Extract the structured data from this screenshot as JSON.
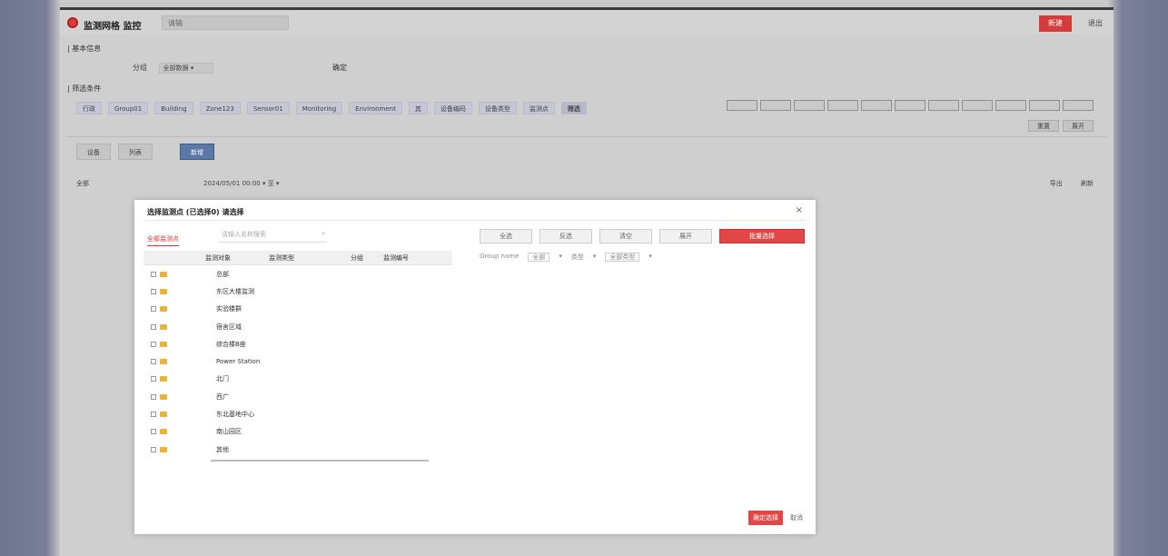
{
  "app": {
    "title": "监测网格 监控",
    "search_placeholder": "请输",
    "top_button": "新建",
    "user": "退出"
  },
  "section1": {
    "label": "| 基本信息",
    "field_label": "分组",
    "field_value": "全部数据 ▾",
    "right_label": "确定"
  },
  "section2": {
    "label": "| 筛选条件",
    "chips": [
      "行政",
      "Group01",
      "Building",
      "Zone123",
      "Sensor01",
      "Monitoring",
      "Environment",
      "其",
      "设备编码",
      "设备类型",
      "监测点",
      "筛选"
    ]
  },
  "mini_buttons": [
    "重置",
    "展开"
  ],
  "tabs": [
    "设备",
    "列表",
    "新增"
  ],
  "filter": {
    "left": "全部",
    "mid": "2024/05/01 00:00 ▾  至  ▾",
    "right": [
      "导出",
      "刷新"
    ]
  },
  "modal": {
    "title": "选择监测点 (已选择0) 请选择",
    "close": "×",
    "tab": "全部监测点",
    "search_placeholder": "请输入名称搜索",
    "buttons": [
      "全选",
      "反选",
      "清空",
      "展开"
    ],
    "primary_button": "批量选择",
    "row2": [
      "Group name",
      "全部",
      "▾",
      "类型",
      "▾",
      "全部类型",
      "▾"
    ],
    "columns": [
      "",
      "监测对象",
      "监测类型",
      "分组",
      "监测编号"
    ],
    "rows": [
      "总部",
      "东区大楼监测",
      "实验楼群",
      "宿舍区域",
      "综合楼B座",
      "Power Station",
      "北门",
      "西广",
      "东北基地中心",
      "南山园区",
      "其他"
    ],
    "ok": "确定选择",
    "cancel": "取消"
  }
}
